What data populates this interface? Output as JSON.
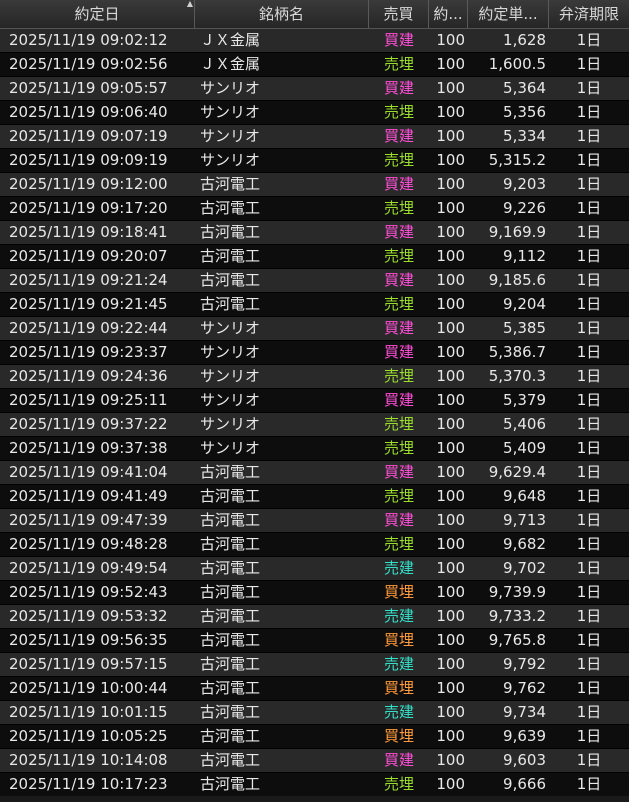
{
  "colors": {
    "kaidate": "#ff4fd8",
    "uriume": "#9bdc2e",
    "uridate": "#33e0c8",
    "kaiume": "#ff9a3c"
  },
  "columns": [
    {
      "key": "date",
      "label": "約定日",
      "sorted": "ascending"
    },
    {
      "key": "name",
      "label": "銘柄名"
    },
    {
      "key": "side",
      "label": "売買"
    },
    {
      "key": "qty",
      "label": "約..."
    },
    {
      "key": "price",
      "label": "約定単..."
    },
    {
      "key": "term",
      "label": "弁済期限"
    }
  ],
  "rows": [
    {
      "date": "2025/11/19 09:02:12",
      "name": "ＪＸ金属",
      "side": "買建",
      "qty": "100",
      "price": "1,628",
      "term": "1日"
    },
    {
      "date": "2025/11/19 09:02:56",
      "name": "ＪＸ金属",
      "side": "売埋",
      "qty": "100",
      "price": "1,600.5",
      "term": "1日"
    },
    {
      "date": "2025/11/19 09:05:57",
      "name": "サンリオ",
      "side": "買建",
      "qty": "100",
      "price": "5,364",
      "term": "1日"
    },
    {
      "date": "2025/11/19 09:06:40",
      "name": "サンリオ",
      "side": "売埋",
      "qty": "100",
      "price": "5,356",
      "term": "1日"
    },
    {
      "date": "2025/11/19 09:07:19",
      "name": "サンリオ",
      "side": "買建",
      "qty": "100",
      "price": "5,334",
      "term": "1日"
    },
    {
      "date": "2025/11/19 09:09:19",
      "name": "サンリオ",
      "side": "売埋",
      "qty": "100",
      "price": "5,315.2",
      "term": "1日"
    },
    {
      "date": "2025/11/19 09:12:00",
      "name": "古河電工",
      "side": "買建",
      "qty": "100",
      "price": "9,203",
      "term": "1日"
    },
    {
      "date": "2025/11/19 09:17:20",
      "name": "古河電工",
      "side": "売埋",
      "qty": "100",
      "price": "9,226",
      "term": "1日"
    },
    {
      "date": "2025/11/19 09:18:41",
      "name": "古河電工",
      "side": "買建",
      "qty": "100",
      "price": "9,169.9",
      "term": "1日"
    },
    {
      "date": "2025/11/19 09:20:07",
      "name": "古河電工",
      "side": "売埋",
      "qty": "100",
      "price": "9,112",
      "term": "1日"
    },
    {
      "date": "2025/11/19 09:21:24",
      "name": "古河電工",
      "side": "買建",
      "qty": "100",
      "price": "9,185.6",
      "term": "1日"
    },
    {
      "date": "2025/11/19 09:21:45",
      "name": "古河電工",
      "side": "売埋",
      "qty": "100",
      "price": "9,204",
      "term": "1日"
    },
    {
      "date": "2025/11/19 09:22:44",
      "name": "サンリオ",
      "side": "買建",
      "qty": "100",
      "price": "5,385",
      "term": "1日"
    },
    {
      "date": "2025/11/19 09:23:37",
      "name": "サンリオ",
      "side": "買建",
      "qty": "100",
      "price": "5,386.7",
      "term": "1日"
    },
    {
      "date": "2025/11/19 09:24:36",
      "name": "サンリオ",
      "side": "売埋",
      "qty": "100",
      "price": "5,370.3",
      "term": "1日"
    },
    {
      "date": "2025/11/19 09:25:11",
      "name": "サンリオ",
      "side": "買建",
      "qty": "100",
      "price": "5,379",
      "term": "1日"
    },
    {
      "date": "2025/11/19 09:37:22",
      "name": "サンリオ",
      "side": "売埋",
      "qty": "100",
      "price": "5,406",
      "term": "1日"
    },
    {
      "date": "2025/11/19 09:37:38",
      "name": "サンリオ",
      "side": "売埋",
      "qty": "100",
      "price": "5,409",
      "term": "1日"
    },
    {
      "date": "2025/11/19 09:41:04",
      "name": "古河電工",
      "side": "買建",
      "qty": "100",
      "price": "9,629.4",
      "term": "1日"
    },
    {
      "date": "2025/11/19 09:41:49",
      "name": "古河電工",
      "side": "売埋",
      "qty": "100",
      "price": "9,648",
      "term": "1日"
    },
    {
      "date": "2025/11/19 09:47:39",
      "name": "古河電工",
      "side": "買建",
      "qty": "100",
      "price": "9,713",
      "term": "1日"
    },
    {
      "date": "2025/11/19 09:48:28",
      "name": "古河電工",
      "side": "売埋",
      "qty": "100",
      "price": "9,682",
      "term": "1日"
    },
    {
      "date": "2025/11/19 09:49:54",
      "name": "古河電工",
      "side": "売建",
      "qty": "100",
      "price": "9,702",
      "term": "1日"
    },
    {
      "date": "2025/11/19 09:52:43",
      "name": "古河電工",
      "side": "買埋",
      "qty": "100",
      "price": "9,739.9",
      "term": "1日"
    },
    {
      "date": "2025/11/19 09:53:32",
      "name": "古河電工",
      "side": "売建",
      "qty": "100",
      "price": "9,733.2",
      "term": "1日"
    },
    {
      "date": "2025/11/19 09:56:35",
      "name": "古河電工",
      "side": "買埋",
      "qty": "100",
      "price": "9,765.8",
      "term": "1日"
    },
    {
      "date": "2025/11/19 09:57:15",
      "name": "古河電工",
      "side": "売建",
      "qty": "100",
      "price": "9,792",
      "term": "1日"
    },
    {
      "date": "2025/11/19 10:00:44",
      "name": "古河電工",
      "side": "買埋",
      "qty": "100",
      "price": "9,762",
      "term": "1日"
    },
    {
      "date": "2025/11/19 10:01:15",
      "name": "古河電工",
      "side": "売建",
      "qty": "100",
      "price": "9,734",
      "term": "1日"
    },
    {
      "date": "2025/11/19 10:05:25",
      "name": "古河電工",
      "side": "買埋",
      "qty": "100",
      "price": "9,639",
      "term": "1日"
    },
    {
      "date": "2025/11/19 10:14:08",
      "name": "古河電工",
      "side": "買建",
      "qty": "100",
      "price": "9,603",
      "term": "1日"
    },
    {
      "date": "2025/11/19 10:17:23",
      "name": "古河電工",
      "side": "売埋",
      "qty": "100",
      "price": "9,666",
      "term": "1日"
    }
  ]
}
